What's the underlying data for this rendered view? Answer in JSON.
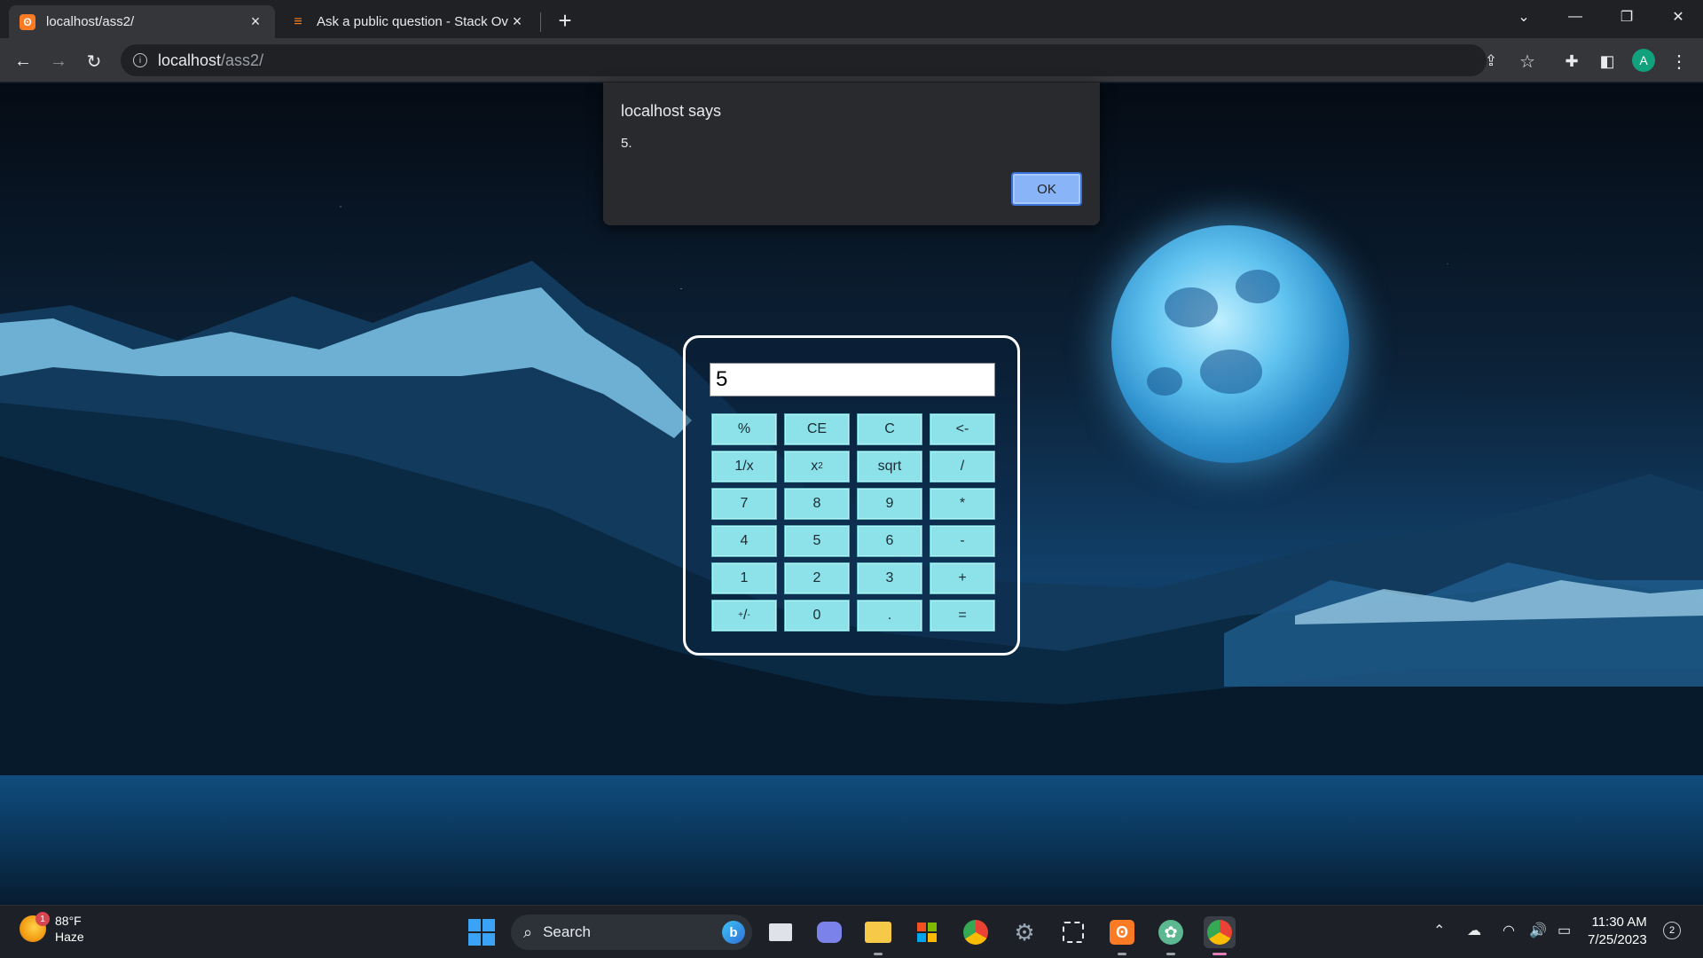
{
  "browser": {
    "tabs": [
      {
        "title": "localhost/ass2/",
        "active": true,
        "favicon": "xampp-icon"
      },
      {
        "title": "Ask a public question - Stack Ove",
        "active": false,
        "favicon": "stackoverflow-icon"
      }
    ],
    "url_host": "localhost",
    "url_path": "/ass2/",
    "profile_initial": "A"
  },
  "dialog": {
    "title": "localhost says",
    "message": "5.",
    "ok_label": "OK"
  },
  "calculator": {
    "display_value": "5",
    "keys": [
      {
        "label": "%",
        "name": "percent"
      },
      {
        "label": "CE",
        "name": "clear-entry"
      },
      {
        "label": "C",
        "name": "clear"
      },
      {
        "label": "<-",
        "name": "backspace"
      },
      {
        "label": "1/x",
        "name": "reciprocal"
      },
      {
        "label": "x",
        "sup": "2",
        "name": "square"
      },
      {
        "label": "sqrt",
        "name": "sqrt"
      },
      {
        "label": "/",
        "name": "divide"
      },
      {
        "label": "7",
        "name": "digit-7"
      },
      {
        "label": "8",
        "name": "digit-8"
      },
      {
        "label": "9",
        "name": "digit-9"
      },
      {
        "label": "*",
        "name": "multiply"
      },
      {
        "label": "4",
        "name": "digit-4"
      },
      {
        "label": "5",
        "name": "digit-5"
      },
      {
        "label": "6",
        "name": "digit-6"
      },
      {
        "label": "-",
        "name": "subtract"
      },
      {
        "label": "1",
        "name": "digit-1"
      },
      {
        "label": "2",
        "name": "digit-2"
      },
      {
        "label": "3",
        "name": "digit-3"
      },
      {
        "label": "+",
        "name": "add"
      },
      {
        "label": "",
        "sup": "+",
        "sub": "-",
        "sep": "/",
        "name": "plus-minus"
      },
      {
        "label": "0",
        "name": "digit-0"
      },
      {
        "label": ".",
        "name": "decimal"
      },
      {
        "label": "=",
        "name": "equals"
      }
    ]
  },
  "taskbar": {
    "weather_temp": "88°F",
    "weather_desc": "Haze",
    "weather_badge": "1",
    "search_placeholder": "Search",
    "clock_time": "11:30 AM",
    "clock_date": "7/25/2023",
    "notification_count": "2",
    "apps": [
      "task-view-icon",
      "teams-icon",
      "file-explorer-icon",
      "store-icon",
      "chrome-icon",
      "settings-icon",
      "snipping-tool-icon",
      "xampp-icon",
      "chatgpt-icon",
      "chrome-profile-icon"
    ]
  }
}
